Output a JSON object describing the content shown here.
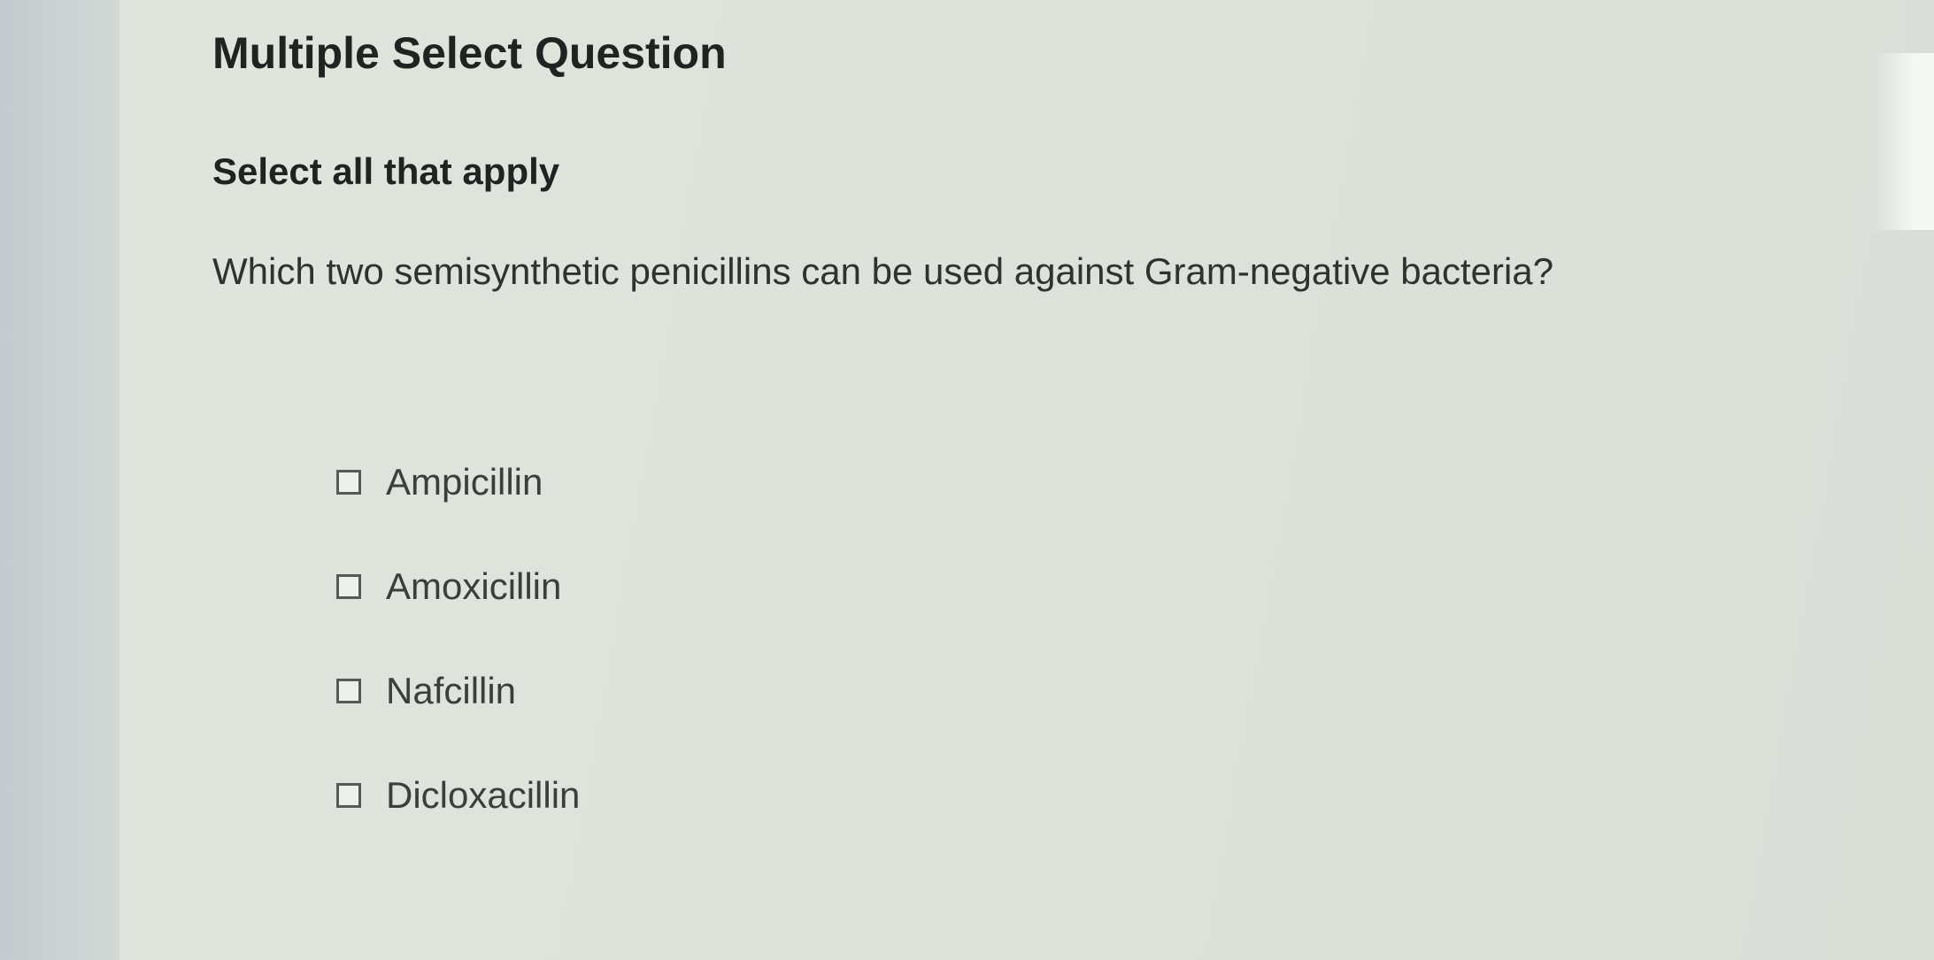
{
  "question": {
    "type_title": "Multiple Select Question",
    "instruction": "Select all that apply",
    "prompt": "Which two semisynthetic penicillins can be used against Gram-negative bacteria?",
    "options": [
      {
        "label": "Ampicillin",
        "checked": false
      },
      {
        "label": "Amoxicillin",
        "checked": false
      },
      {
        "label": "Nafcillin",
        "checked": false
      },
      {
        "label": "Dicloxacillin",
        "checked": false
      }
    ]
  }
}
